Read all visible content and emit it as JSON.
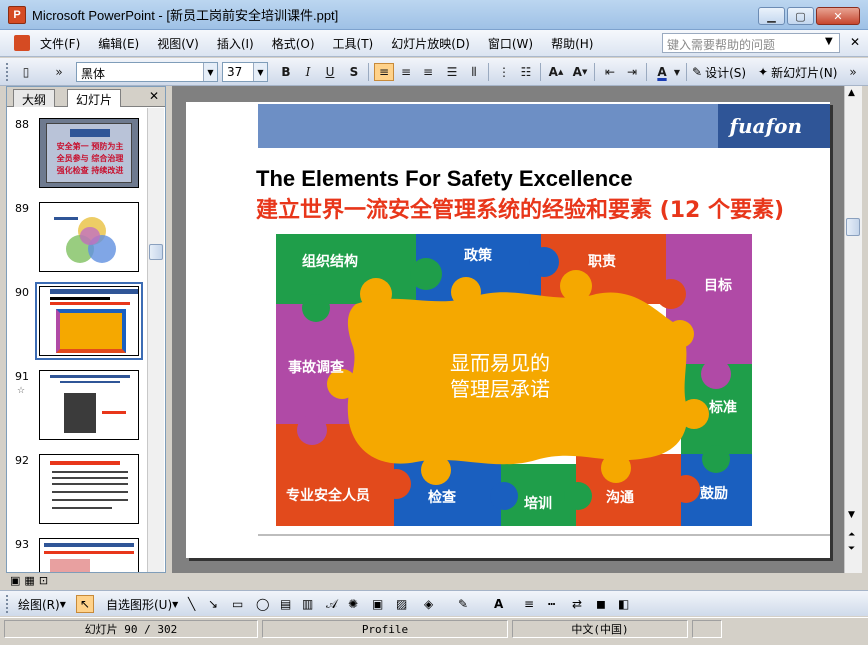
{
  "window": {
    "title": "Microsoft PowerPoint - [新员工岗前安全培训课件.ppt]",
    "app_icon_letter": "P"
  },
  "menu": {
    "items": [
      "文件(F)",
      "编辑(E)",
      "视图(V)",
      "插入(I)",
      "格式(O)",
      "工具(T)",
      "幻灯片放映(D)",
      "窗口(W)",
      "帮助(H)"
    ],
    "help_placeholder": "键入需要帮助的问题"
  },
  "toolbar": {
    "font": "黑体",
    "size": "37",
    "design_label": "设计(S)",
    "new_slide_label": "新幻灯片(N)"
  },
  "left_pane": {
    "tabs": [
      "大纲",
      "幻灯片"
    ],
    "active_tab": "幻灯片",
    "thumbs": [
      {
        "num": "88",
        "has_star": false
      },
      {
        "num": "89",
        "has_star": false
      },
      {
        "num": "90",
        "has_star": false,
        "selected": true
      },
      {
        "num": "91",
        "has_star": true
      },
      {
        "num": "92",
        "has_star": false
      },
      {
        "num": "93",
        "has_star": false
      }
    ],
    "star_glyph": "☆",
    "thumb88_lines": [
      "安全第一 预防为主",
      "全员参与 综合治理",
      "强化检查 持续改进"
    ]
  },
  "slide": {
    "logo": "fuafon",
    "heading_en": "The Elements For Safety Excellence",
    "heading_cn": "建立世界一流安全管理系统的经验和要素 (12 个要素)",
    "center_text_line1": "显而易见的",
    "center_text_line2": "管理层承诺",
    "pieces": [
      "组织结构",
      "政策",
      "职责",
      "目标",
      "事故调查",
      "标准",
      "专业安全人员",
      "检查",
      "培训",
      "沟通",
      "鼓励"
    ],
    "colors": {
      "band_dark": "#2f5597",
      "band_light": "#6d8fc5",
      "heading_cn": "#e8361a",
      "center": "#f5a800",
      "purple": "#b04aa6",
      "green": "#1f9e4a",
      "blue": "#1a5fbf",
      "red": "#e24a1c",
      "orange_red": "#e8361a"
    }
  },
  "drawbar": {
    "draw_label": "绘图(R)",
    "autoshape_label": "自选图形(U)"
  },
  "status": {
    "slide_info": "幻灯片 90 / 302",
    "design": "Profile",
    "language": "中文(中国)"
  }
}
